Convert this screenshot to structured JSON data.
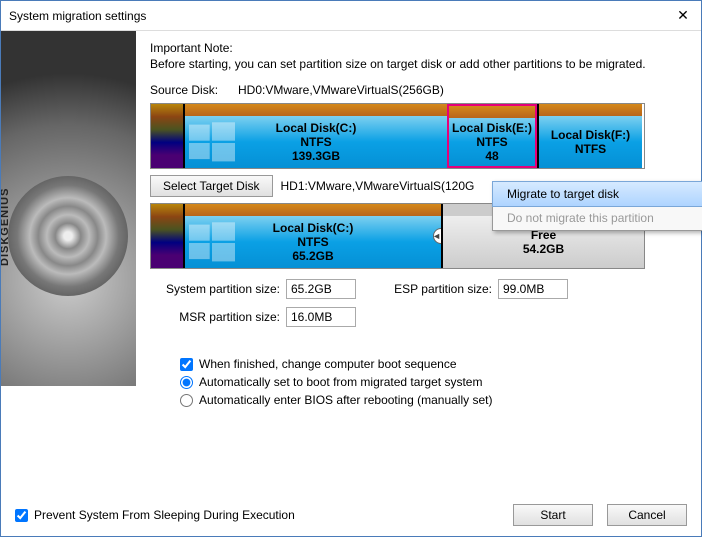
{
  "window": {
    "title": "System migration settings"
  },
  "note": {
    "title": "Important Note:",
    "body": "Before starting, you can set partition size on target disk or add other partitions to be migrated."
  },
  "source": {
    "label": "Source Disk:",
    "text": "HD0:VMware,VMwareVirtualS(256GB)",
    "partitions": [
      {
        "name": "Local Disk(C:)",
        "fs": "NTFS",
        "size": "139.3GB"
      },
      {
        "name": "Local Disk(E:)",
        "fs": "NTFS",
        "size": "48"
      },
      {
        "name": "Local Disk(F:)",
        "fs": "NTFS",
        "size": ""
      }
    ]
  },
  "target": {
    "button": "Select Target Disk",
    "text": "HD1:VMware,VMwareVirtualS(120G",
    "partitions": [
      {
        "name": "Local Disk(C:)",
        "fs": "NTFS",
        "size": "65.2GB"
      },
      {
        "name": "Free",
        "size": "54.2GB"
      }
    ]
  },
  "fields": {
    "sys_label": "System partition size:",
    "sys_value": "65.2GB",
    "msr_label": "MSR partition size:",
    "msr_value": "16.0MB",
    "esp_label": "ESP partition size:",
    "esp_value": "99.0MB"
  },
  "options": {
    "cb1": "When finished, change computer boot sequence",
    "r1": "Automatically set to boot from migrated target system",
    "r2": "Automatically enter BIOS after rebooting (manually set)"
  },
  "bottom": {
    "sleep": "Prevent System From Sleeping During Execution",
    "start": "Start",
    "cancel": "Cancel"
  },
  "ctx": {
    "migrate": "Migrate to target disk",
    "dont": "Do not migrate this partition"
  },
  "brand": "DISKGENIUS"
}
